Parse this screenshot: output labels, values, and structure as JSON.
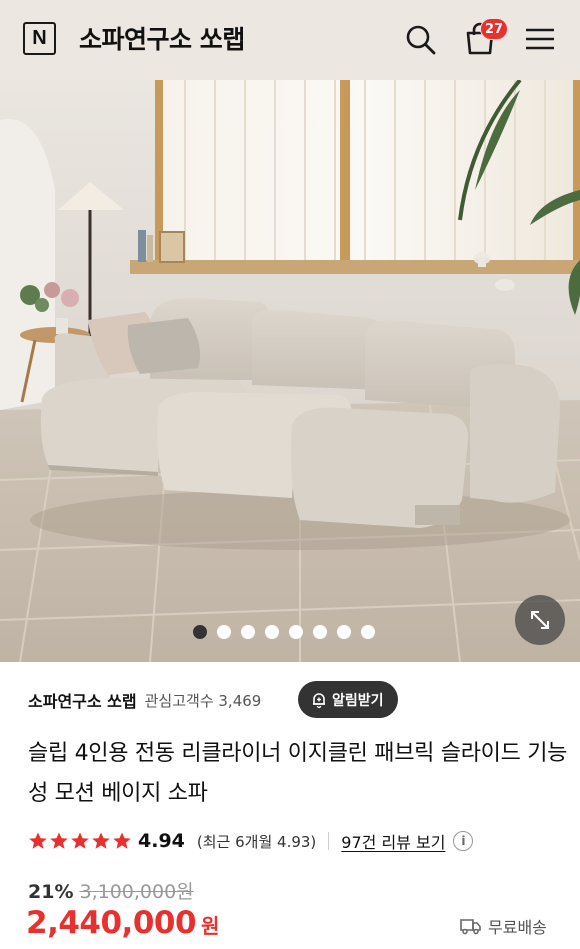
{
  "header": {
    "logo_letter": "N",
    "store_name": "소파연구소 쏘랩",
    "cart_count": "27",
    "icons": [
      "search-icon",
      "shopping-bag-icon",
      "menu-icon"
    ]
  },
  "hero": {
    "image_description_icon": "photo",
    "total_images": 8,
    "active_index": 0
  },
  "product": {
    "store_name": "소파연구소 쏘랩",
    "interest_label": "관심고객수 3,469",
    "alarm_label": "알림받기",
    "title": "슬립 4인용 전동 리클라이너 이지클린 패브릭 슬라이드 기능성 모션 베이지 소파",
    "rating": {
      "score": "4.94",
      "stars": 5,
      "recent": "(최근 6개월 4.93)",
      "review_link": "97건 리뷰 보기"
    },
    "discount": "21%",
    "original_price": "3,100,000원",
    "price": "2,440,000",
    "currency": "원",
    "shipping": "무료배송"
  },
  "colors": {
    "header_bg": "#ede7e2",
    "badge": "#e8312f",
    "price": "#e8312f",
    "star": "#e8312f"
  }
}
